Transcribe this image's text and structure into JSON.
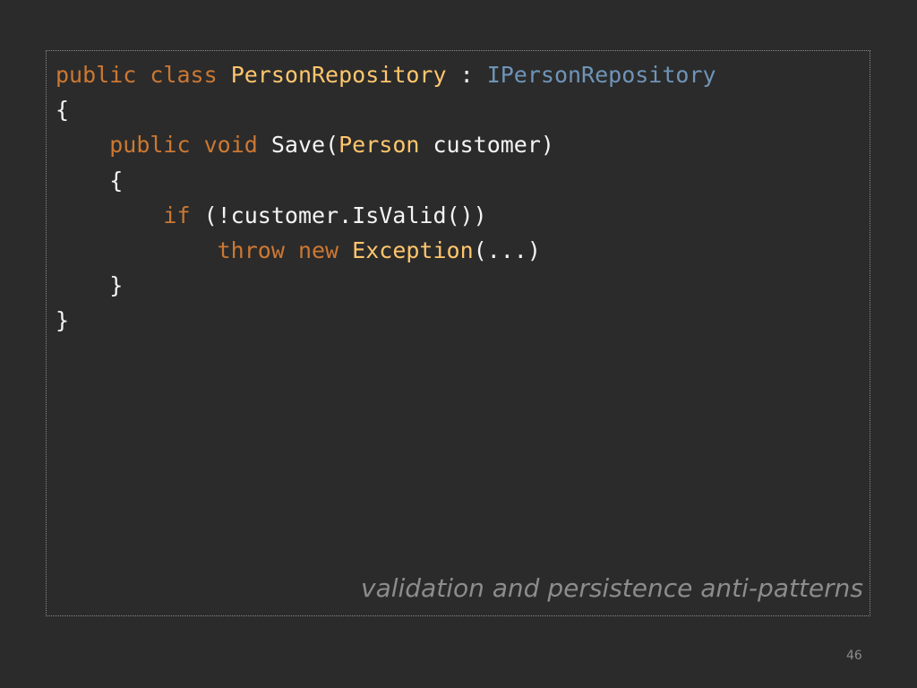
{
  "slide": {
    "code_lines": [
      {
        "tokens": [
          {
            "text": "public",
            "kind": "kw"
          },
          {
            "text": " ",
            "kind": "plain"
          },
          {
            "text": "class",
            "kind": "kw"
          },
          {
            "text": " ",
            "kind": "plain"
          },
          {
            "text": "PersonRepository",
            "kind": "type"
          },
          {
            "text": " : ",
            "kind": "plain"
          },
          {
            "text": "IPersonRepository",
            "kind": "iface"
          }
        ]
      },
      {
        "tokens": [
          {
            "text": "{",
            "kind": "plain"
          }
        ]
      },
      {
        "tokens": [
          {
            "text": "    ",
            "kind": "plain"
          },
          {
            "text": "public",
            "kind": "kw"
          },
          {
            "text": " ",
            "kind": "plain"
          },
          {
            "text": "void",
            "kind": "kw"
          },
          {
            "text": " Save(",
            "kind": "plain"
          },
          {
            "text": "Person",
            "kind": "type"
          },
          {
            "text": " customer)",
            "kind": "plain"
          }
        ]
      },
      {
        "tokens": [
          {
            "text": "    {",
            "kind": "plain"
          }
        ]
      },
      {
        "tokens": [
          {
            "text": "        ",
            "kind": "plain"
          },
          {
            "text": "if",
            "kind": "kw"
          },
          {
            "text": " (!customer.IsValid())",
            "kind": "plain"
          }
        ]
      },
      {
        "tokens": [
          {
            "text": "            ",
            "kind": "plain"
          },
          {
            "text": "throw",
            "kind": "kw"
          },
          {
            "text": " ",
            "kind": "plain"
          },
          {
            "text": "new",
            "kind": "kw"
          },
          {
            "text": " ",
            "kind": "plain"
          },
          {
            "text": "Exception",
            "kind": "type"
          },
          {
            "text": "(...)",
            "kind": "plain"
          }
        ]
      },
      {
        "tokens": [
          {
            "text": "    }",
            "kind": "plain"
          }
        ]
      },
      {
        "tokens": [
          {
            "text": "}",
            "kind": "plain"
          }
        ]
      }
    ],
    "caption": "validation and persistence anti-patterns",
    "page_number": "46"
  },
  "colors": {
    "background": "#2b2b2b",
    "keyword": "#cc7832",
    "type": "#ffc66d",
    "interface": "#6f94b8",
    "text": "#f4f4f4",
    "caption": "#8c8c8c"
  }
}
